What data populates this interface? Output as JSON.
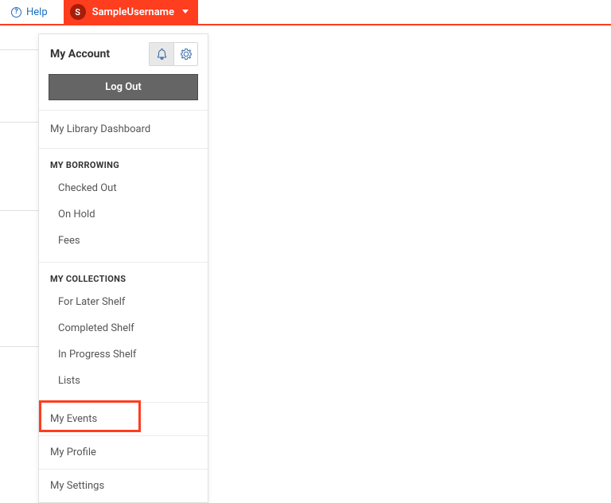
{
  "topbar": {
    "help_label": "Help",
    "username": "SampleUsername",
    "avatar_initial": "S"
  },
  "dropdown": {
    "title": "My Account",
    "logout_label": "Log Out",
    "dashboard_label": "My Library Dashboard",
    "borrowing": {
      "header": "My Borrowing",
      "checked_out": "Checked Out",
      "on_hold": "On Hold",
      "fees": "Fees"
    },
    "collections": {
      "header": "My Collections",
      "for_later": "For Later Shelf",
      "completed": "Completed Shelf",
      "in_progress": "In Progress Shelf",
      "lists": "Lists"
    },
    "events_label": "My Events",
    "profile_label": "My Profile",
    "settings_label": "My Settings"
  },
  "highlight": {
    "target": "my-settings"
  }
}
